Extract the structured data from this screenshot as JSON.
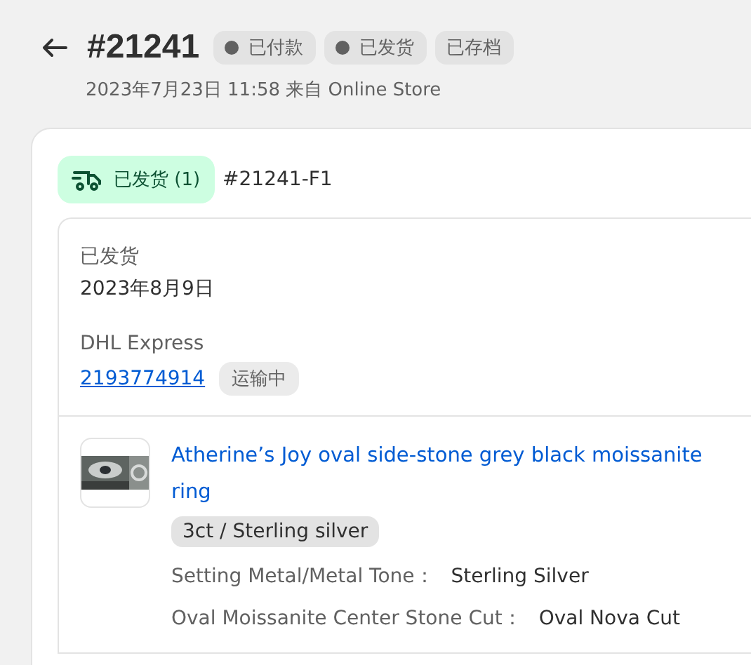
{
  "header": {
    "order_number": "#21241",
    "tags": [
      {
        "label": "已付款",
        "kind": "dot"
      },
      {
        "label": "已发货",
        "kind": "dot"
      },
      {
        "label": "已存档",
        "kind": "plain"
      }
    ],
    "subtitle": "2023年7月23日 11:58 来自 Online Store"
  },
  "fulfillment": {
    "status": "已发货 (1)",
    "id": "#21241-F1",
    "state_label": "已发货",
    "date": "2023年8月9日",
    "carrier": "DHL Express",
    "tracking_number": "2193774914",
    "tracking_status": "运输中",
    "item": {
      "title": "Atherine’s Joy oval side-stone grey black moissanite ring",
      "variant": "3ct / Sterling silver",
      "properties": [
        {
          "name": "Setting Metal/Metal Tone：",
          "value": "Sterling Silver"
        },
        {
          "name": "Oval Moissanite Center Stone Cut：",
          "value": "Oval Nova Cut"
        }
      ]
    }
  }
}
